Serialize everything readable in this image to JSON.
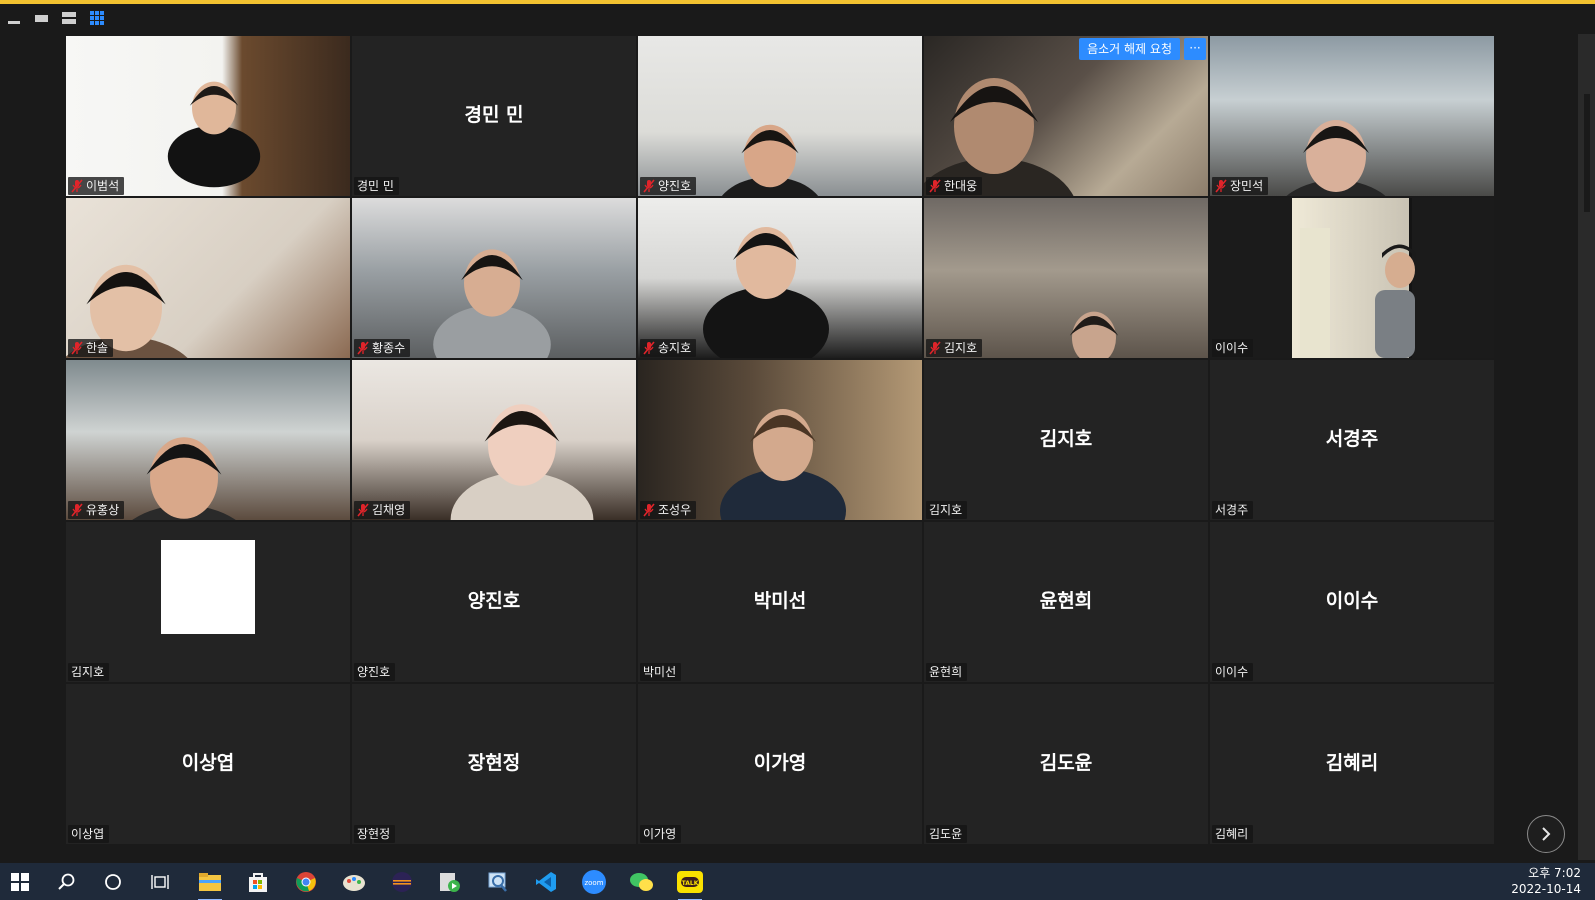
{
  "meeting": {
    "unmute_request_label": "음소거 해제 요청",
    "more_label": "···"
  },
  "tiles": [
    {
      "name": "이범석",
      "center": "",
      "muted": true,
      "video": true,
      "active": true
    },
    {
      "name": "경민 민",
      "center": "경민 민",
      "muted": false,
      "video": false,
      "active": false
    },
    {
      "name": "양진호",
      "center": "",
      "muted": true,
      "video": true,
      "active": false
    },
    {
      "name": "한대웅",
      "center": "",
      "muted": true,
      "video": true,
      "active": false
    },
    {
      "name": "장민석",
      "center": "",
      "muted": true,
      "video": true,
      "active": false
    },
    {
      "name": "한솔",
      "center": "",
      "muted": true,
      "video": true,
      "active": false
    },
    {
      "name": "황종수",
      "center": "",
      "muted": true,
      "video": true,
      "active": false
    },
    {
      "name": "송지호",
      "center": "",
      "muted": true,
      "video": true,
      "active": false
    },
    {
      "name": "김지호",
      "center": "",
      "muted": true,
      "video": true,
      "active": false
    },
    {
      "name": "이이수",
      "center": "",
      "muted": false,
      "video": true,
      "active": false
    },
    {
      "name": "유홍상",
      "center": "",
      "muted": true,
      "video": true,
      "active": false
    },
    {
      "name": "김채영",
      "center": "",
      "muted": true,
      "video": true,
      "active": false
    },
    {
      "name": "조성우",
      "center": "",
      "muted": true,
      "video": true,
      "active": false
    },
    {
      "name": "김지호",
      "center": "김지호",
      "muted": false,
      "video": false,
      "active": false
    },
    {
      "name": "서경주",
      "center": "서경주",
      "muted": false,
      "video": false,
      "active": false
    },
    {
      "name": "김지호",
      "center": "",
      "muted": false,
      "video": false,
      "active": false
    },
    {
      "name": "양진호",
      "center": "양진호",
      "muted": false,
      "video": false,
      "active": false
    },
    {
      "name": "박미선",
      "center": "박미선",
      "muted": false,
      "video": false,
      "active": false
    },
    {
      "name": "윤현희",
      "center": "윤현희",
      "muted": false,
      "video": false,
      "active": false
    },
    {
      "name": "이이수",
      "center": "이이수",
      "muted": false,
      "video": false,
      "active": false
    },
    {
      "name": "이상엽",
      "center": "이상엽",
      "muted": false,
      "video": false,
      "active": false
    },
    {
      "name": "장현정",
      "center": "장현정",
      "muted": false,
      "video": false,
      "active": false
    },
    {
      "name": "이가영",
      "center": "이가영",
      "muted": false,
      "video": false,
      "active": false
    },
    {
      "name": "김도윤",
      "center": "김도윤",
      "muted": false,
      "video": false,
      "active": false
    },
    {
      "name": "김혜리",
      "center": "김혜리",
      "muted": false,
      "video": false,
      "active": false
    }
  ],
  "taskbar": {
    "icons": [
      "windows-start-icon",
      "search-icon",
      "cortana-icon",
      "task-view-icon",
      "file-explorer-icon",
      "microsoft-store-icon",
      "chrome-icon",
      "paint-icon",
      "eclipse-icon",
      "media-player-icon",
      "magnifier-icon",
      "vscode-icon",
      "zoom-icon",
      "wechat-icon",
      "kakaotalk-icon"
    ],
    "kakaotalk_label": "TALK",
    "zoom_label": "zoom",
    "clock_time": "오후 7:02",
    "clock_date": "2022-10-14"
  },
  "colors": {
    "accent_yellow": "#f2c230",
    "zoom_blue": "#2d8cff",
    "mute_red": "#e0242a"
  }
}
